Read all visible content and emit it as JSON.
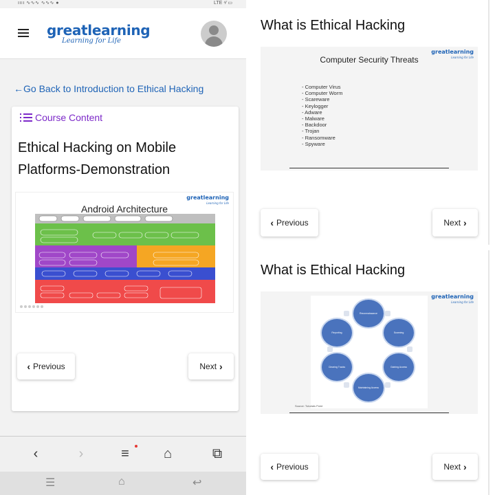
{
  "left_phone": {
    "statusbar": {
      "left": "ıııı ∿∿∿ ∿∿∿ ●",
      "right": "LTE ⁴⁄ ▭"
    },
    "header": {
      "logo_main": "greatlearning",
      "logo_sub": "Learning for Life"
    },
    "back_link": "←Go Back to Introduction to Ethical Hacking",
    "course_content": "Course Content",
    "lesson_title": "Ethical Hacking on Mobile Platforms-Demonstration",
    "slide": {
      "title": "Android Architecture",
      "brand": "greatlearning",
      "brand_sub": "Learning for Life"
    },
    "prev_label": "Previous",
    "next_label": "Next",
    "browser_nav": {
      "back": "‹",
      "forward": "›",
      "menu": "≡",
      "home": "⌂",
      "tabs": "⧉"
    },
    "system_nav": {
      "recent": "☰",
      "home": "⌂",
      "back": "↩"
    }
  },
  "right_top": {
    "title": "What is Ethical Hacking",
    "slide_title": "Computer Security Threats",
    "brand": "greatlearning",
    "brand_sub": "Learning for Life",
    "threats": [
      "Computer Virus",
      "Computer Worm",
      "Scareware",
      "Keylogger",
      "Adware",
      "Malware",
      "Backdoor",
      "Trojan",
      "Ransomware",
      "Spyware"
    ],
    "prev_label": "Previous",
    "next_label": "Next"
  },
  "right_bottom": {
    "title": "What is Ethical Hacking",
    "brand": "greatlearning",
    "brand_sub": "Learning for Life",
    "cycle_nodes": [
      "Reconnaissance",
      "Scanning",
      "Gaining Access",
      "Maintaining Access",
      "Clearing Tracks",
      "Reporting"
    ],
    "source": "Source: Tutorials Point",
    "prev_label": "Previous",
    "next_label": "Next"
  },
  "colors": {
    "brand_blue": "#1e63b6",
    "course_purple": "#7c29c8"
  }
}
